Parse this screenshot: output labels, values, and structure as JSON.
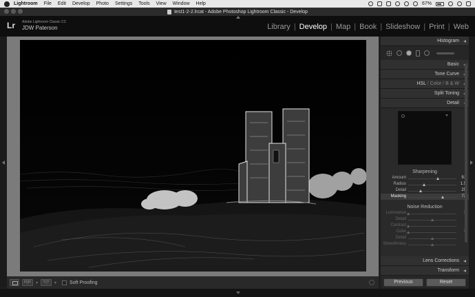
{
  "menubar": {
    "items": [
      "Lightroom",
      "File",
      "Edit",
      "Develop",
      "Photo",
      "Settings",
      "Tools",
      "View",
      "Window",
      "Help"
    ],
    "battery": "67%"
  },
  "window": {
    "title": "test1-2-2.lrcat - Adobe Photoshop Lightroom Classic - Develop"
  },
  "identity": {
    "logo": "Lr",
    "catalog": "Adobe Lightroom Classic CC",
    "author": "JDW Paterson"
  },
  "modules": {
    "items": [
      "Library",
      "Develop",
      "Map",
      "Book",
      "Slideshow",
      "Print",
      "Web"
    ],
    "active": "Develop"
  },
  "toolbar": {
    "soft_proofing": "Soft Proofing",
    "before_after": "Y|Y"
  },
  "panels": {
    "histogram": "Histogram",
    "basic": "Basic",
    "tone_curve": "Tone Curve",
    "hsl": "HSL",
    "color": "Color",
    "bw": "B & W",
    "split_toning": "Split Toning",
    "detail": "Detail",
    "lens_corrections": "Lens Corrections",
    "transform": "Transform"
  },
  "sharpening": {
    "title": "Sharpening",
    "sliders": [
      {
        "label": "Amount",
        "value": "91",
        "pos": 0.61
      },
      {
        "label": "Radius",
        "value": "1.5",
        "pos": 0.33
      },
      {
        "label": "Detail",
        "value": "25",
        "pos": 0.25
      },
      {
        "label": "Masking",
        "value": "72",
        "pos": 0.72
      }
    ]
  },
  "noise_reduction": {
    "title": "Noise Reduction",
    "sliders": [
      {
        "label": "Luminance",
        "value": "0",
        "pos": 0.0
      },
      {
        "label": "Detail",
        "value": "",
        "pos": 0.5
      },
      {
        "label": "Contrast",
        "value": "",
        "pos": 0.0
      },
      {
        "label": "Color",
        "value": "0",
        "pos": 0.0
      },
      {
        "label": "Detail",
        "value": "",
        "pos": 0.5
      },
      {
        "label": "Smoothness",
        "value": "",
        "pos": 0.5
      }
    ]
  },
  "buttons": {
    "previous": "Previous",
    "reset": "Reset"
  }
}
